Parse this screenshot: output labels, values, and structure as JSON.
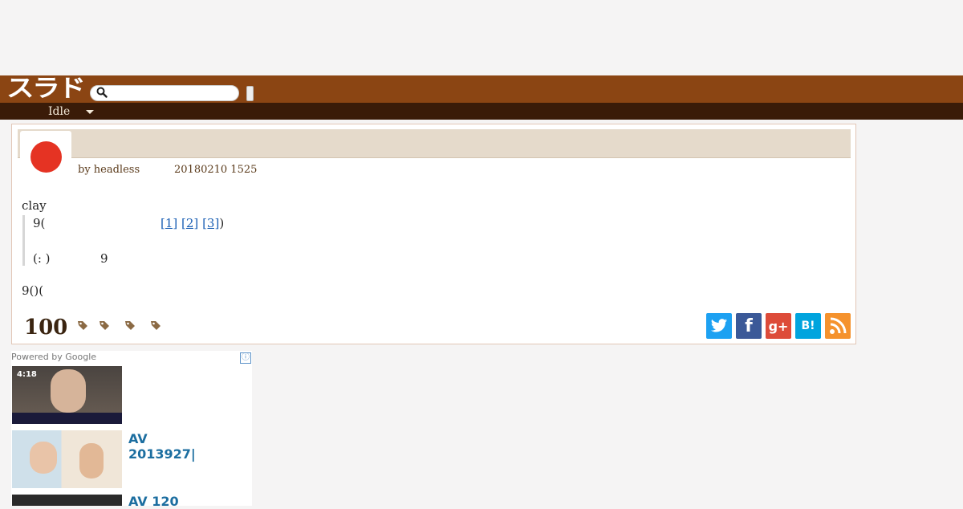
{
  "header": {
    "logo": "スラド",
    "search_placeholder": "",
    "mode_label": "Idle"
  },
  "article": {
    "byline": "by headless",
    "date": "20180210 1525",
    "lead": "clay",
    "quote_line1_prefix": "9(",
    "refs": [
      "[1]",
      "[2]",
      "[3]"
    ],
    "quote_line1_suffix": ")",
    "quote_line2_a": "(: )",
    "quote_line2_b": "9",
    "closing": "9()(",
    "comment_count": "100"
  },
  "tags": [
    "tag-icon",
    "tag-icon",
    "tag-icon",
    "tag-icon"
  ],
  "share": {
    "twitter_icon": "twitter-icon",
    "facebook_label": "f",
    "gplus_label": "g+",
    "hatena_label": "B!",
    "rss_icon": "rss-icon"
  },
  "ads": {
    "powered_by": "Powered by Google",
    "info_icon": "ⓘ",
    "items": [
      {
        "title": "",
        "thumb_time": "4:18"
      },
      {
        "title": "AV\n2013927|"
      },
      {
        "title": "AV 120"
      }
    ]
  },
  "colors": {
    "topbar": "#8b4513",
    "subbar": "#3a1b08",
    "accent_red": "#e53323",
    "link": "#1a5fb4"
  }
}
